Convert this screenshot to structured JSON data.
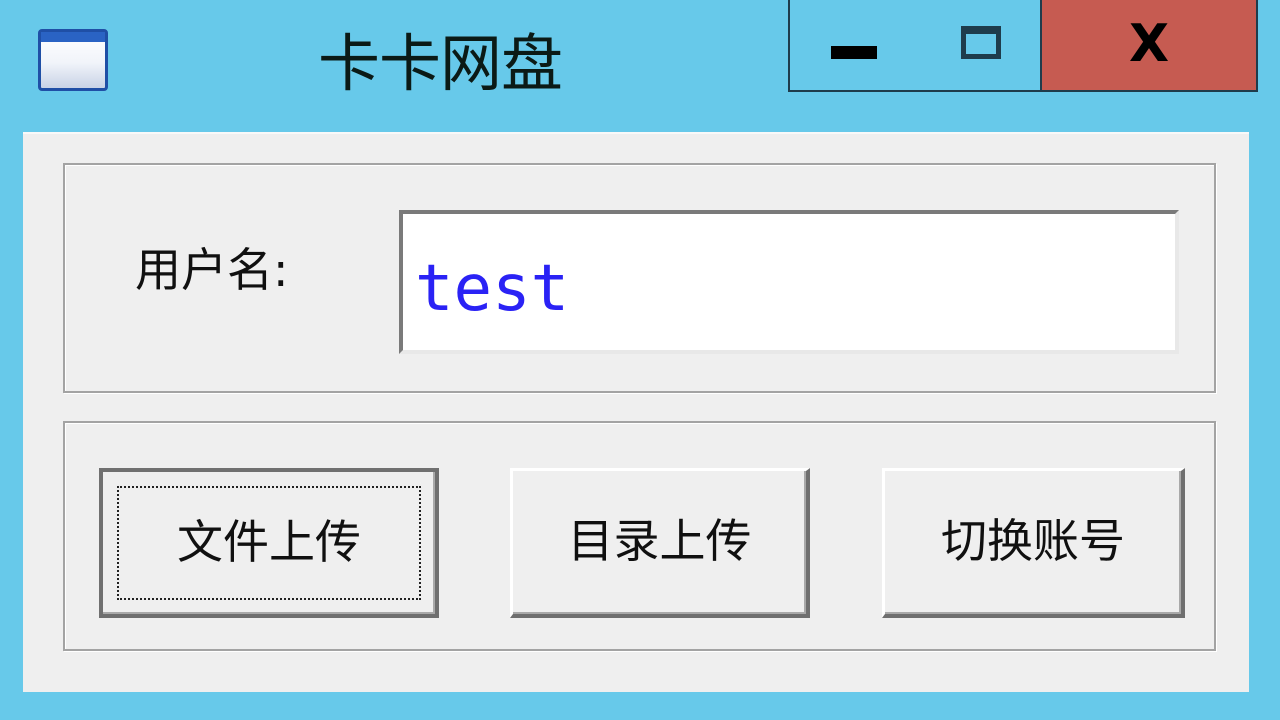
{
  "window": {
    "title": "卡卡网盘",
    "icon": "application-window-icon",
    "controls": {
      "minimize": "minimize-icon",
      "maximize": "maximize-icon",
      "close_label": "X"
    },
    "colors": {
      "titlebar": "#67c9ea",
      "close": "#c65b51",
      "client": "#efefef"
    }
  },
  "user": {
    "label": "用户名:",
    "value": "test",
    "value_color": "#2a22f5"
  },
  "actions": {
    "upload_file": "文件上传",
    "upload_directory": "目录上传",
    "switch_account": "切换账号"
  }
}
